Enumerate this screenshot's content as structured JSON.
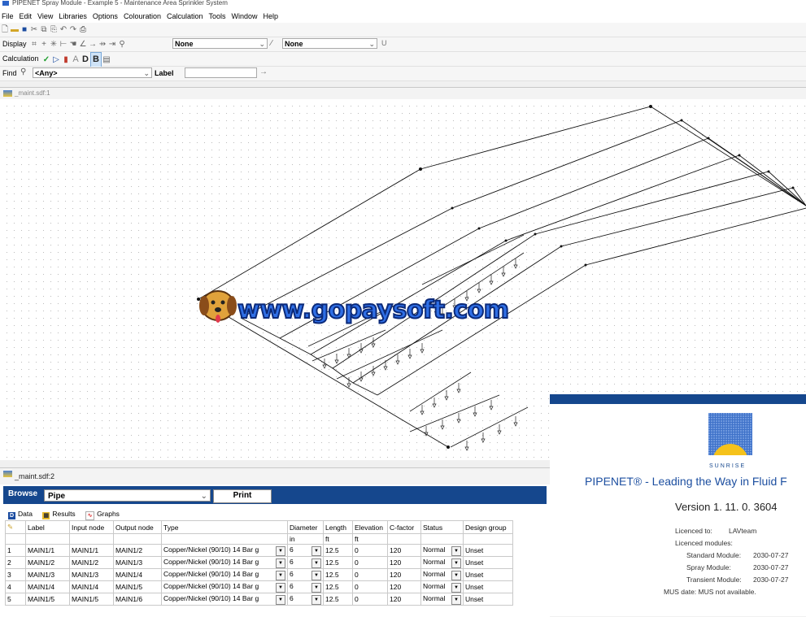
{
  "window": {
    "title": "PIPENET Spray Module - Example 5 - Maintenance Area Sprinkler System"
  },
  "menu": [
    "File",
    "Edit",
    "View",
    "Libraries",
    "Options",
    "Colouration",
    "Calculation",
    "Tools",
    "Window",
    "Help"
  ],
  "toolbar_display": {
    "label": "Display",
    "combo1": "None",
    "combo2": "None"
  },
  "toolbar_calc": {
    "label": "Calculation"
  },
  "toolbar_find": {
    "label": "Find",
    "combo": "<Any>",
    "label_text": "Label"
  },
  "doc1": {
    "tab": "_maint.sdf:1"
  },
  "doc2": {
    "tab": "_maint.sdf:2"
  },
  "browse": {
    "label": "Browse",
    "selected": "Pipe",
    "print": "Print"
  },
  "subtabs": [
    "Data",
    "Results",
    "Graphs"
  ],
  "table": {
    "headers": [
      "",
      "Label",
      "Input node",
      "Output node",
      "Type",
      "Diameter",
      "Length",
      "Elevation",
      "C-factor",
      "Status",
      "Design group"
    ],
    "units": [
      "",
      "",
      "",
      "",
      "",
      "in",
      "ft",
      "ft",
      "",
      "",
      ""
    ],
    "rows": [
      [
        "1",
        "MAIN1/1",
        "MAIN1/1",
        "MAIN1/2",
        "Copper/Nickel (90/10) 14 Bar g",
        "6",
        "12.5",
        "0",
        "120",
        "Normal",
        "Unset"
      ],
      [
        "2",
        "MAIN1/2",
        "MAIN1/2",
        "MAIN1/3",
        "Copper/Nickel (90/10) 14 Bar g",
        "6",
        "12.5",
        "0",
        "120",
        "Normal",
        "Unset"
      ],
      [
        "3",
        "MAIN1/3",
        "MAIN1/3",
        "MAIN1/4",
        "Copper/Nickel (90/10) 14 Bar g",
        "6",
        "12.5",
        "0",
        "120",
        "Normal",
        "Unset"
      ],
      [
        "4",
        "MAIN1/4",
        "MAIN1/4",
        "MAIN1/5",
        "Copper/Nickel (90/10) 14 Bar g",
        "6",
        "12.5",
        "0",
        "120",
        "Normal",
        "Unset"
      ],
      [
        "5",
        "MAIN1/5",
        "MAIN1/5",
        "MAIN1/6",
        "Copper/Nickel (90/10) 14 Bar g",
        "6",
        "12.5",
        "0",
        "120",
        "Normal",
        "Unset"
      ]
    ]
  },
  "splash": {
    "brand": "SUNRISE",
    "tagline": "PIPENET® - Leading the Way in Fluid F",
    "version": "Version 1. 11. 0. 3604",
    "licenced_to_label": "Licenced to:",
    "licenced_to": "LAVteam",
    "modules_label": "Licenced modules:",
    "modules": [
      {
        "name": "Standard Module:",
        "date": "2030-07-27"
      },
      {
        "name": "Spray Module:",
        "date": "2030-07-27"
      },
      {
        "name": "Transient Module:",
        "date": "2030-07-27"
      }
    ],
    "mus": "MUS date: MUS not available."
  },
  "watermark": {
    "text": "www.gopaysoft.com"
  },
  "colors": {
    "accent": "#15478d",
    "watermark": "#2f6fe6"
  }
}
